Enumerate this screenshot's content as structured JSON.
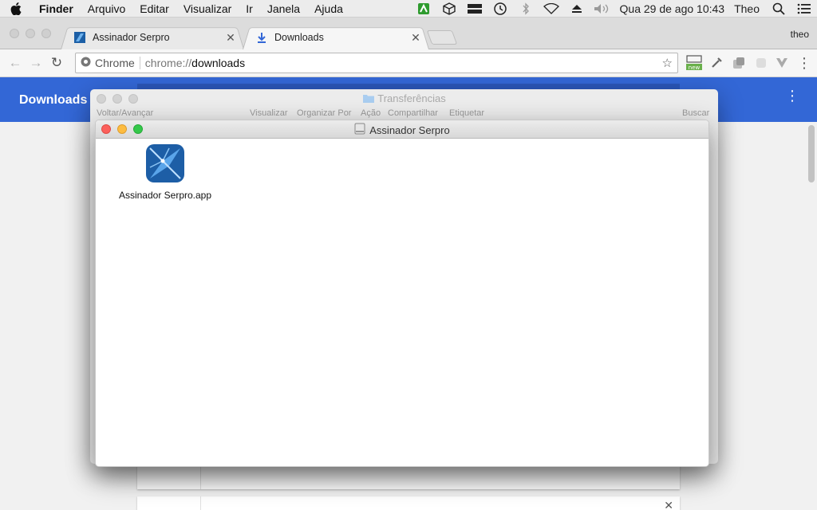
{
  "menubar": {
    "app_name": "Finder",
    "items": [
      "Arquivo",
      "Editar",
      "Visualizar",
      "Ir",
      "Janela",
      "Ajuda"
    ],
    "clock": "Qua 29 de ago  10:43",
    "user": "Theo"
  },
  "chrome": {
    "tabs": [
      {
        "title": "Assinador Serpro",
        "icon": "serpro-favicon",
        "active": false
      },
      {
        "title": "Downloads",
        "icon": "download-icon",
        "active": true
      }
    ],
    "profile_name": "theo",
    "omnibox": {
      "chip_label": "Chrome",
      "url_scheme": "chrome://",
      "url_path": "downloads"
    },
    "extension_badge": "new"
  },
  "downloads_page": {
    "title": "Downloads",
    "header_color": "#3367d6"
  },
  "finder_back": {
    "title": "Transferências",
    "toolbar_labels": {
      "back_forward": "Voltar/Avançar",
      "view": "Visualizar",
      "arrange": "Organizar Por",
      "action": "Ação",
      "share": "Compartilhar",
      "tag": "Etiquetar",
      "search": "Buscar"
    }
  },
  "finder_front": {
    "title": "Assinador Serpro",
    "items": [
      {
        "name": "Assinador Serpro.app",
        "icon": "serpro-app-icon"
      }
    ]
  }
}
